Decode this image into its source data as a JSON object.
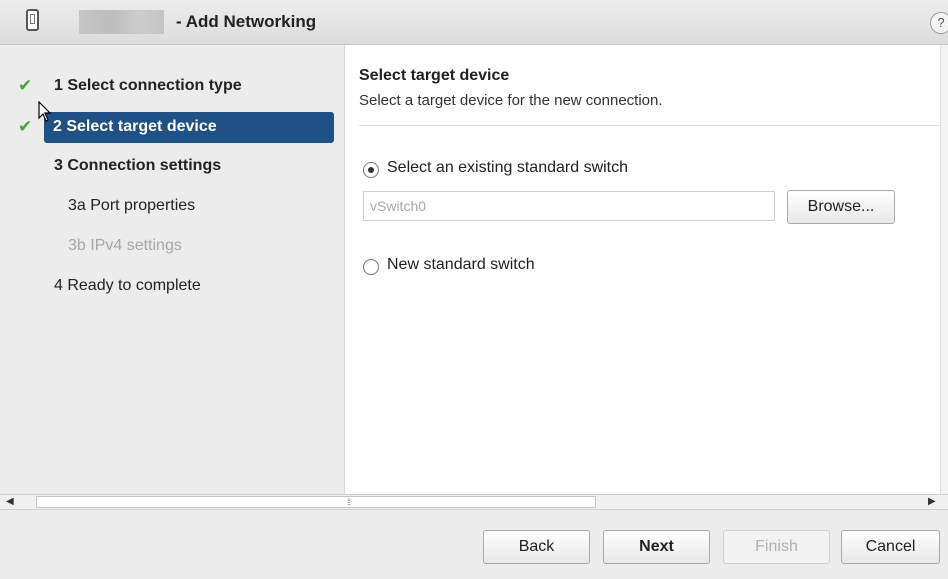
{
  "window": {
    "title": "- Add Networking",
    "help_label": "?"
  },
  "steps": [
    {
      "label": "1  Select connection type",
      "completed": true
    },
    {
      "label": "2  Select target device",
      "completed": true,
      "active": true
    },
    {
      "label": "3  Connection settings"
    },
    {
      "label": "3a  Port properties"
    },
    {
      "label": "3b  IPv4 settings",
      "disabled": true
    },
    {
      "label": "4  Ready to complete"
    }
  ],
  "content": {
    "heading": "Select target device",
    "description": "Select a target device for the new connection.",
    "options": [
      {
        "label": "Select an existing standard switch",
        "selected": true
      },
      {
        "label": "New standard switch",
        "selected": false
      }
    ],
    "switch_value": "vSwitch0",
    "browse_label": "Browse..."
  },
  "footer": {
    "back_label": "Back",
    "next_label": "Next",
    "finish_label": "Finish",
    "cancel_label": "Cancel"
  },
  "colors": {
    "active_step": "#1f5185",
    "check": "#4aa33c",
    "sidebar_bg": "#ececec"
  }
}
